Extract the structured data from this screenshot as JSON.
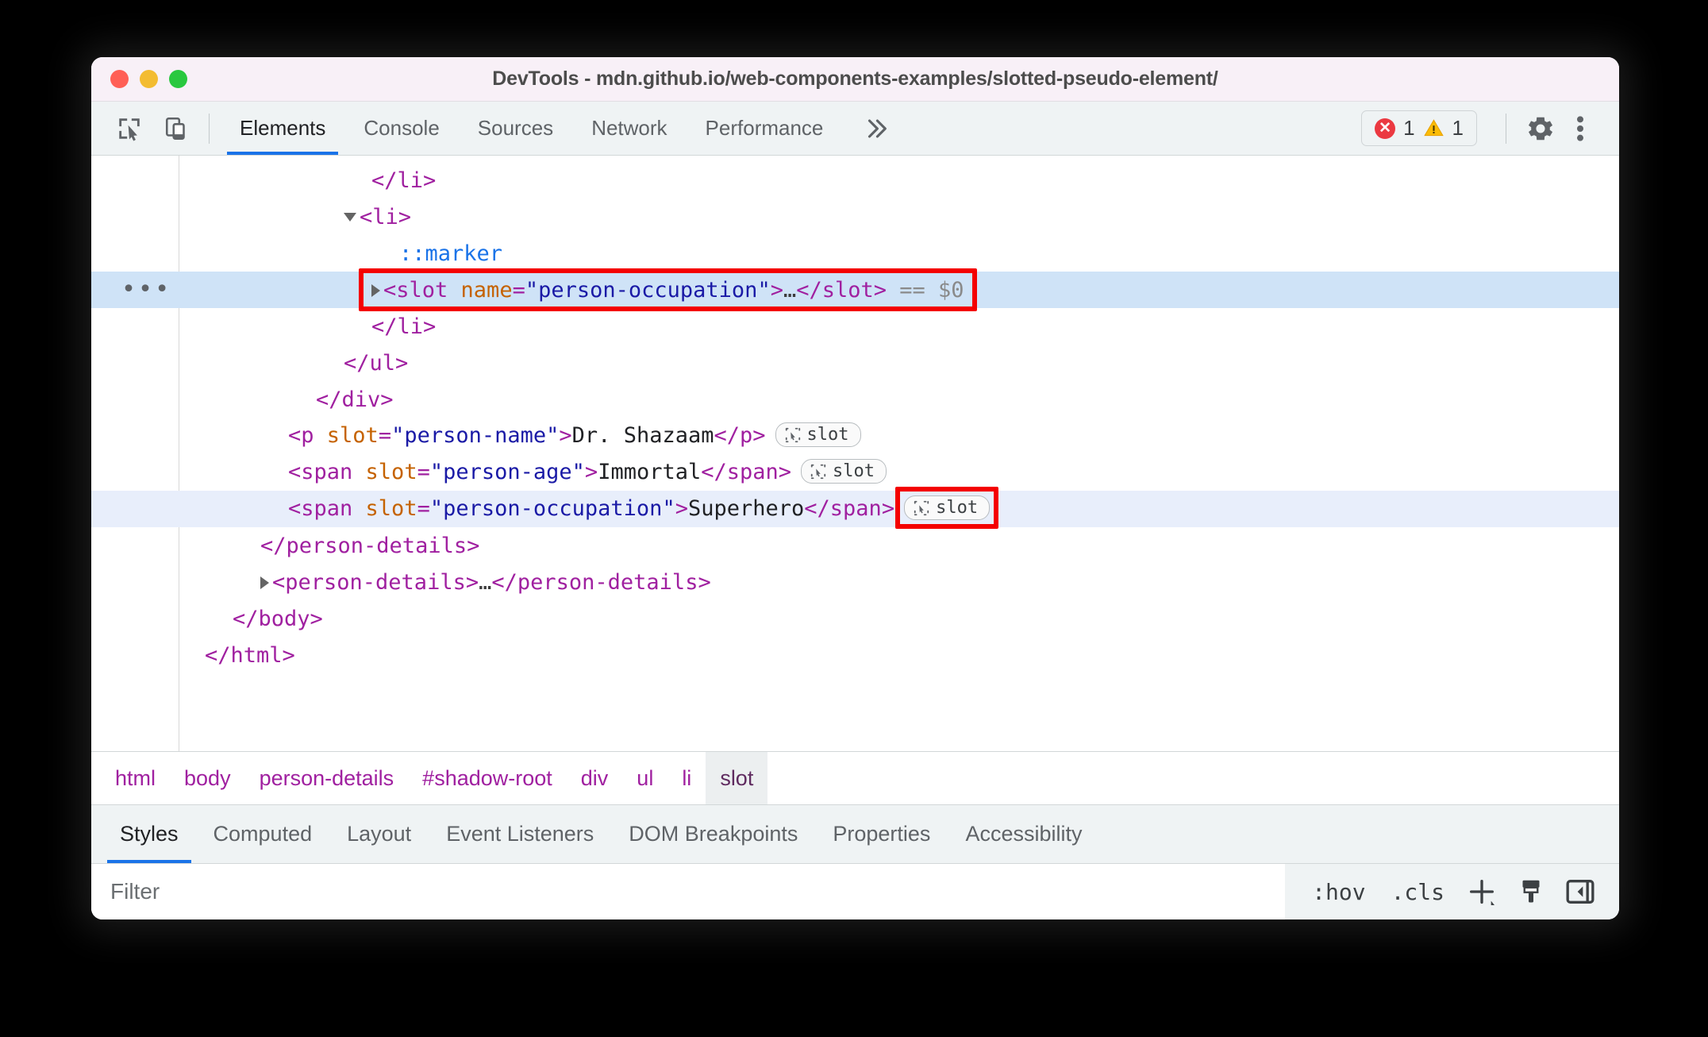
{
  "window": {
    "title": "DevTools - mdn.github.io/web-components-examples/slotted-pseudo-element/",
    "traffic_lights": [
      {
        "name": "close",
        "color": "#ff5f56"
      },
      {
        "name": "minimize",
        "color": "#f3bc31"
      },
      {
        "name": "maximize",
        "color": "#29c83f"
      }
    ]
  },
  "toolbar": {
    "inspect_icon": "inspect-element-icon",
    "device_icon": "device-toolbar-icon",
    "tabs": [
      {
        "label": "Elements",
        "active": true
      },
      {
        "label": "Console",
        "active": false
      },
      {
        "label": "Sources",
        "active": false
      },
      {
        "label": "Network",
        "active": false
      },
      {
        "label": "Performance",
        "active": false
      }
    ],
    "more_tabs_icon": "chevron-double-right-icon",
    "issues": {
      "error_icon": "error-circle-icon",
      "error_count": "1",
      "warning_icon": "warning-triangle-icon",
      "warning_count": "1"
    },
    "settings_icon": "gear-icon",
    "menu_icon": "kebab-menu-icon",
    "accent_color": "#1a73e8"
  },
  "dom_tree": {
    "rows": [
      {
        "id": "row-li-close-1",
        "indent": 215,
        "state": "normal",
        "segments": [
          {
            "cls": "tag",
            "text": "</li>"
          }
        ]
      },
      {
        "id": "row-li-open",
        "indent": 180,
        "state": "normal",
        "twisty": "open",
        "segments": [
          {
            "cls": "tag",
            "text": "<li>"
          }
        ]
      },
      {
        "id": "row-marker",
        "indent": 250,
        "state": "normal",
        "segments": [
          {
            "cls": "pseudo",
            "text": "::marker"
          }
        ]
      },
      {
        "id": "row-slot-selected",
        "indent": 215,
        "state": "selected",
        "twisty": "closed",
        "gutter_dots": "•••",
        "segments": [
          {
            "cls": "tag",
            "text": "<slot "
          },
          {
            "cls": "attr-name",
            "text": "name"
          },
          {
            "cls": "tag",
            "text": "="
          },
          {
            "cls": "attr-val",
            "text": "\"person-occupation\""
          },
          {
            "cls": "tag",
            "text": ">"
          },
          {
            "cls": "ell",
            "text": "…"
          },
          {
            "cls": "tag",
            "text": "</slot>"
          },
          {
            "cls": "dollar",
            "text": " == $0"
          }
        ]
      },
      {
        "id": "row-li-close-2",
        "indent": 215,
        "state": "normal",
        "segments": [
          {
            "cls": "tag",
            "text": "</li>"
          }
        ]
      },
      {
        "id": "row-ul-close",
        "indent": 180,
        "state": "normal",
        "segments": [
          {
            "cls": "tag",
            "text": "</ul>"
          }
        ]
      },
      {
        "id": "row-div-close",
        "indent": 145,
        "state": "normal",
        "segments": [
          {
            "cls": "tag",
            "text": "</div>"
          }
        ]
      },
      {
        "id": "row-p-person-name",
        "indent": 110,
        "state": "normal",
        "badge": "slot",
        "segments": [
          {
            "cls": "tag",
            "text": "<p "
          },
          {
            "cls": "attr-name",
            "text": "slot"
          },
          {
            "cls": "tag",
            "text": "="
          },
          {
            "cls": "attr-val",
            "text": "\"person-name\""
          },
          {
            "cls": "tag",
            "text": ">"
          },
          {
            "cls": "txt",
            "text": "Dr. Shazaam"
          },
          {
            "cls": "tag",
            "text": "</p>"
          }
        ]
      },
      {
        "id": "row-span-person-age",
        "indent": 110,
        "state": "normal",
        "badge": "slot",
        "segments": [
          {
            "cls": "tag",
            "text": "<span "
          },
          {
            "cls": "attr-name",
            "text": "slot"
          },
          {
            "cls": "tag",
            "text": "="
          },
          {
            "cls": "attr-val",
            "text": "\"person-age\""
          },
          {
            "cls": "tag",
            "text": ">"
          },
          {
            "cls": "txt",
            "text": "Immortal"
          },
          {
            "cls": "tag",
            "text": "</span>"
          }
        ]
      },
      {
        "id": "row-span-person-occupation",
        "indent": 110,
        "state": "related",
        "badge": "slot",
        "segments": [
          {
            "cls": "tag",
            "text": "<span "
          },
          {
            "cls": "attr-name",
            "text": "slot"
          },
          {
            "cls": "tag",
            "text": "="
          },
          {
            "cls": "attr-val",
            "text": "\"person-occupation\""
          },
          {
            "cls": "tag",
            "text": ">"
          },
          {
            "cls": "txt",
            "text": "Superhero"
          },
          {
            "cls": "tag",
            "text": "</span>"
          }
        ]
      },
      {
        "id": "row-person-details-close",
        "indent": 75,
        "state": "normal",
        "segments": [
          {
            "cls": "tag",
            "text": "</person-details>"
          }
        ]
      },
      {
        "id": "row-person-details-collapsed",
        "indent": 75,
        "state": "normal",
        "twisty": "closed",
        "segments": [
          {
            "cls": "tag",
            "text": "<person-details>"
          },
          {
            "cls": "ell",
            "text": "…"
          },
          {
            "cls": "tag",
            "text": "</person-details>"
          }
        ]
      },
      {
        "id": "row-body-close",
        "indent": 40,
        "state": "normal",
        "segments": [
          {
            "cls": "tag",
            "text": "</body>"
          }
        ]
      },
      {
        "id": "row-html-close",
        "indent": 5,
        "state": "normal",
        "segments": [
          {
            "cls": "tag",
            "text": "</html>"
          }
        ]
      }
    ],
    "highlight_color": "#f40000",
    "selected_row_bg": "#cfe3f7",
    "related_row_bg": "#e8eefb",
    "badge_label": "slot",
    "badge_icon": "reveal-slot-icon"
  },
  "breadcrumb": {
    "items": [
      {
        "label": "html",
        "active": false
      },
      {
        "label": "body",
        "active": false
      },
      {
        "label": "person-details",
        "active": false
      },
      {
        "label": "#shadow-root",
        "active": false
      },
      {
        "label": "div",
        "active": false
      },
      {
        "label": "ul",
        "active": false
      },
      {
        "label": "li",
        "active": false
      },
      {
        "label": "slot",
        "active": true
      }
    ]
  },
  "sidebar_tabs": [
    {
      "label": "Styles",
      "active": true
    },
    {
      "label": "Computed",
      "active": false
    },
    {
      "label": "Layout",
      "active": false
    },
    {
      "label": "Event Listeners",
      "active": false
    },
    {
      "label": "DOM Breakpoints",
      "active": false
    },
    {
      "label": "Properties",
      "active": false
    },
    {
      "label": "Accessibility",
      "active": false
    }
  ],
  "filter_bar": {
    "placeholder": "Filter",
    "value": "",
    "hov_label": ":hov",
    "cls_label": ".cls",
    "new_rule_icon": "plus-icon",
    "styles_pane_icon": "paintbrush-icon",
    "toggle_sidebar_icon": "collapse-sidebar-icon"
  }
}
